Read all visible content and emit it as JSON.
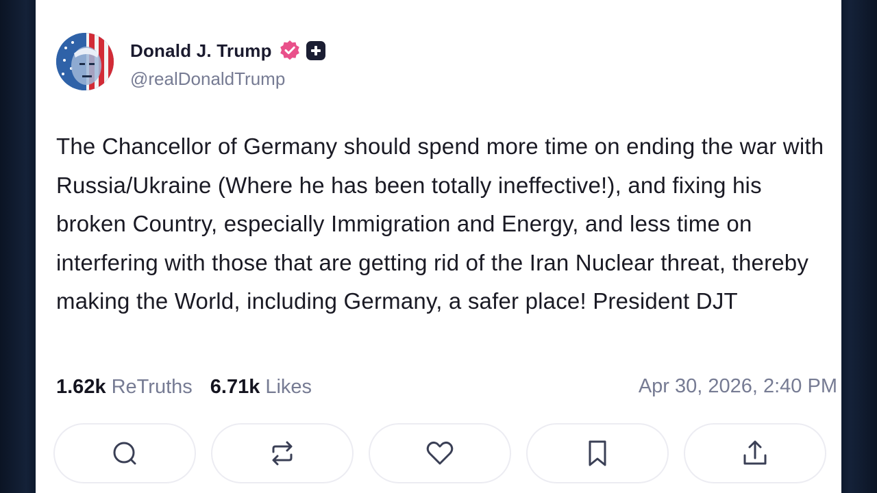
{
  "post": {
    "author": {
      "display_name": "Donald J. Trump",
      "handle": "@realDonaldTrump",
      "verified_icon": "verified-badge-icon",
      "extra_badge_icon": "plus-badge-icon",
      "verified_color": "#e9508a"
    },
    "text": "The Chancellor of Germany should spend more time on ending the war with Russia/Ukraine (Where he has been totally ineffective!), and fixing his broken Country, especially Immigration and Energy, and less time on interfering with those that are getting rid of the Iran Nuclear threat, thereby making the World, including Germany, a safer place! President DJT",
    "stats": {
      "retruths_count": "1.62k",
      "retruths_label": "ReTruths",
      "likes_count": "6.71k",
      "likes_label": "Likes"
    },
    "timestamp": "Apr 30, 2026, 2:40 PM"
  },
  "actions": [
    {
      "icon": "reply-icon"
    },
    {
      "icon": "retruth-icon"
    },
    {
      "icon": "like-icon"
    },
    {
      "icon": "bookmark-icon"
    },
    {
      "icon": "share-icon"
    }
  ]
}
